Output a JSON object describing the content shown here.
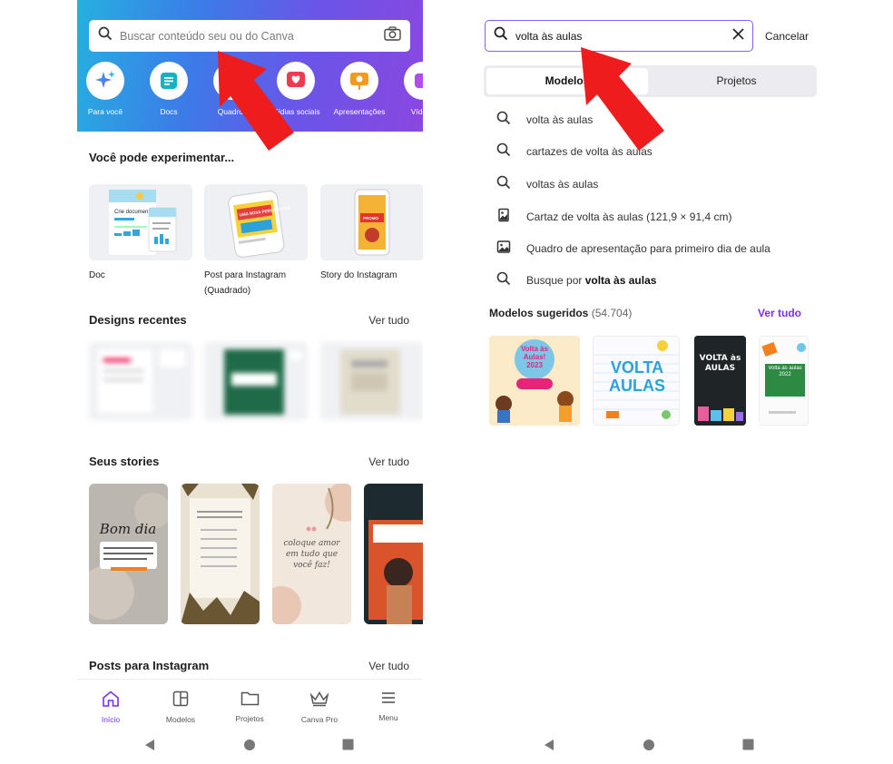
{
  "left": {
    "search": {
      "placeholder": "Buscar conteúdo seu ou do Canva"
    },
    "categories": [
      {
        "label": "Para você",
        "icon": "sparkles-icon"
      },
      {
        "label": "Docs",
        "icon": "doc-icon"
      },
      {
        "label": "Quadros",
        "icon": "board-icon"
      },
      {
        "label": "Mídias sociais",
        "icon": "heart-icon"
      },
      {
        "label": "Apresentações",
        "icon": "presentation-icon"
      },
      {
        "label": "Vídeos",
        "icon": "video-icon"
      }
    ],
    "try_section": {
      "title": "Você pode experimentar...",
      "items": [
        {
          "label": "Doc",
          "thumb_text": "Crie documentos"
        },
        {
          "label": "Post para Instagram (Quadrado)",
          "thumb_text": "UMA NOVA PERSPECTIVA"
        },
        {
          "label": "Story do Instagram",
          "thumb_text": "PROMO"
        }
      ]
    },
    "recent": {
      "title": "Designs recentes",
      "link": "Ver tudo"
    },
    "stories": {
      "title": "Seus stories",
      "link": "Ver tudo",
      "items": [
        {
          "text": "Bom dia"
        },
        {
          "text": ""
        },
        {
          "text": "coloque amor em tudo que você faz!"
        },
        {
          "text": ""
        }
      ]
    },
    "posts": {
      "title": "Posts para Instagram",
      "link": "Ver tudo"
    },
    "fab": "+",
    "nav": [
      {
        "label": "Início",
        "icon": "home-icon",
        "active": true
      },
      {
        "label": "Modelos",
        "icon": "templates-icon",
        "active": false
      },
      {
        "label": "Projetos",
        "icon": "folder-icon",
        "active": false
      },
      {
        "label": "Canva Pro",
        "icon": "crown-icon",
        "active": false
      },
      {
        "label": "Menu",
        "icon": "menu-icon",
        "active": false
      }
    ]
  },
  "right": {
    "search": {
      "value": "volta às aulas"
    },
    "cancel": "Cancelar",
    "tabs": [
      {
        "label": "Modelos",
        "active": true
      },
      {
        "label": "Projetos",
        "active": false
      }
    ],
    "suggestions": [
      {
        "icon": "search-icon",
        "text": "volta às aulas"
      },
      {
        "icon": "search-icon",
        "text": "cartazes de volta às aulas"
      },
      {
        "icon": "search-icon",
        "text": "voltas às aulas"
      },
      {
        "icon": "poster-icon",
        "text": "Cartaz de volta às aulas (121,9 × 91,4 cm)"
      },
      {
        "icon": "image-icon",
        "text": "Quadro de apresentação para primeiro dia de aula"
      },
      {
        "icon": "search-icon",
        "prefix": "Busque por ",
        "bold": "volta às aulas"
      }
    ],
    "models": {
      "title": "Modelos sugeridos",
      "count": "(54.704)",
      "link": "Ver tudo",
      "thumbs": [
        {
          "text": "Volta às Aulas! 2023"
        },
        {
          "text": "VOLTA AULAS"
        },
        {
          "text": "VOLTA às AULAS"
        },
        {
          "text": "Volta às aulas 2022"
        }
      ]
    }
  },
  "colors": {
    "accent": "#7b2ff2",
    "arrow": "#ee1c1c"
  }
}
